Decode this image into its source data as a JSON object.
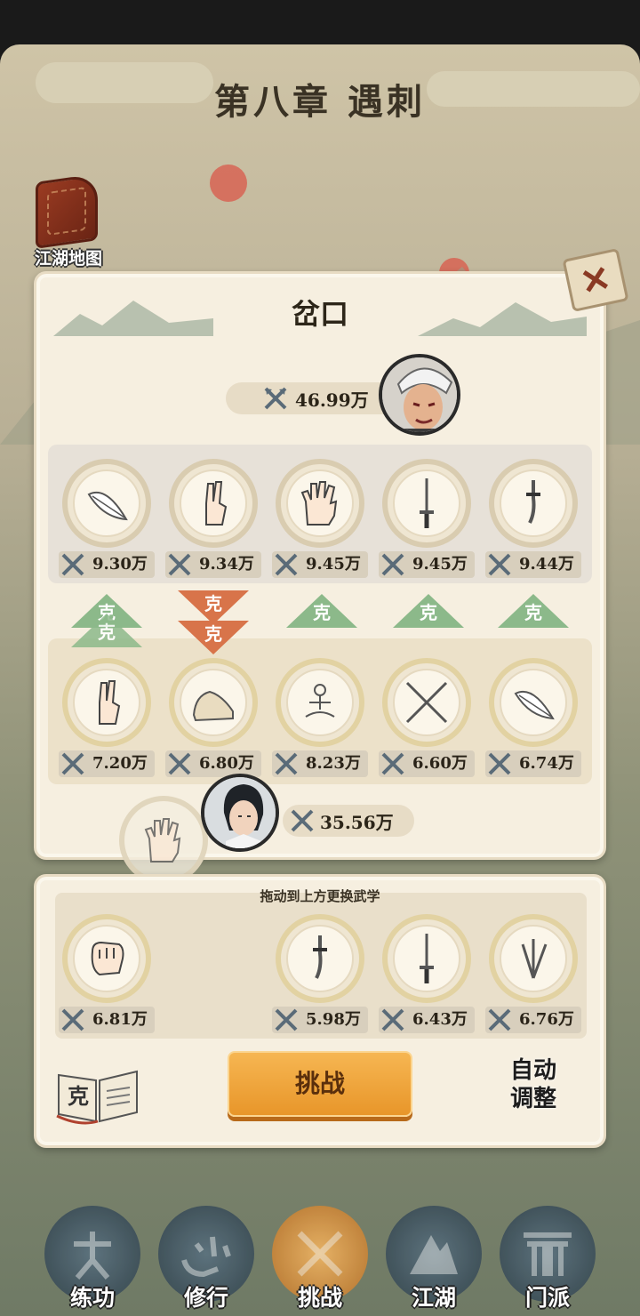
{
  "chapter": {
    "title": "第八章 遇刺"
  },
  "map_button": {
    "label": "江湖地图"
  },
  "battle": {
    "location": "岔口",
    "enemy_power": "46.99万",
    "player_power": "35.56万",
    "enemy_skills": [
      {
        "icon": "feather-icon",
        "power": "9.30万"
      },
      {
        "icon": "two-finger-hand-icon",
        "power": "9.34万"
      },
      {
        "icon": "palm-hand-icon",
        "power": "9.45万"
      },
      {
        "icon": "sword-icon",
        "power": "9.45万"
      },
      {
        "icon": "saber-icon",
        "power": "9.44万"
      }
    ],
    "counters": [
      {
        "label": "克",
        "state": "green"
      },
      {
        "label": "克",
        "state": "red"
      },
      {
        "label": "克",
        "state": "green"
      },
      {
        "label": "克",
        "state": "green"
      },
      {
        "label": "克",
        "state": "green"
      }
    ],
    "player_skills": [
      {
        "icon": "two-finger-hand-icon",
        "power": "7.20万"
      },
      {
        "icon": "boot-icon",
        "power": "6.80万"
      },
      {
        "icon": "meditation-icon",
        "power": "8.23万"
      },
      {
        "icon": "crossed-swords-icon",
        "power": "6.60万"
      },
      {
        "icon": "feather-icon",
        "power": "6.74万"
      }
    ]
  },
  "inventory": {
    "hint": "拖动到上方更换武学",
    "items": [
      {
        "icon": "fist-icon",
        "power": "6.81万"
      },
      {
        "icon": "saber-icon",
        "power": "5.98万"
      },
      {
        "icon": "sword-icon",
        "power": "6.43万"
      },
      {
        "icon": "daggers-icon",
        "power": "6.76万"
      }
    ]
  },
  "actions": {
    "challenge": "挑战",
    "auto_adjust_line1": "自动",
    "auto_adjust_line2": "调整",
    "book_char": "克"
  },
  "nav": [
    {
      "label": "练功",
      "icon": "martial-figure-icon",
      "active": false
    },
    {
      "label": "修行",
      "icon": "heart-char-icon",
      "active": false
    },
    {
      "label": "挑战",
      "icon": "crossed-swords-icon",
      "active": true
    },
    {
      "label": "江湖",
      "icon": "mountain-icon",
      "active": false
    },
    {
      "label": "门派",
      "icon": "gate-icon",
      "active": false
    }
  ],
  "colors": {
    "accent": "#e8962a",
    "counter_green": "#8cb98a",
    "counter_red": "#d8744a"
  }
}
